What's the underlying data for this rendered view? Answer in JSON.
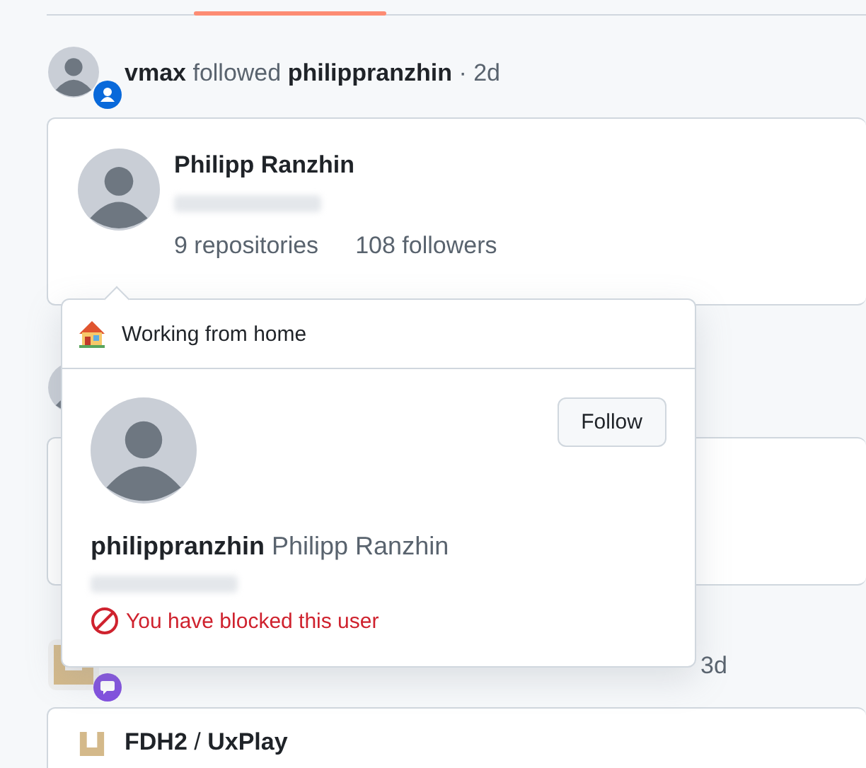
{
  "feed": [
    {
      "kind": "follow",
      "actor": "vmax",
      "action": "followed",
      "target": "philippranzhin",
      "time": "· 2d",
      "card": {
        "name": "Philipp Ranzhin",
        "repositories": "9 repositories",
        "followers": "108 followers"
      }
    },
    {
      "kind": "covered"
    },
    {
      "kind": "discussion",
      "time": "3d",
      "card": {
        "repo_owner": "FDH2",
        "separator": "/",
        "repo_name": "UxPlay"
      }
    }
  ],
  "hovercard": {
    "status": "Working from home",
    "follow_button": "Follow",
    "login": "philippranzhin",
    "name": "Philipp Ranzhin",
    "blocked_notice": "You have blocked this user"
  }
}
